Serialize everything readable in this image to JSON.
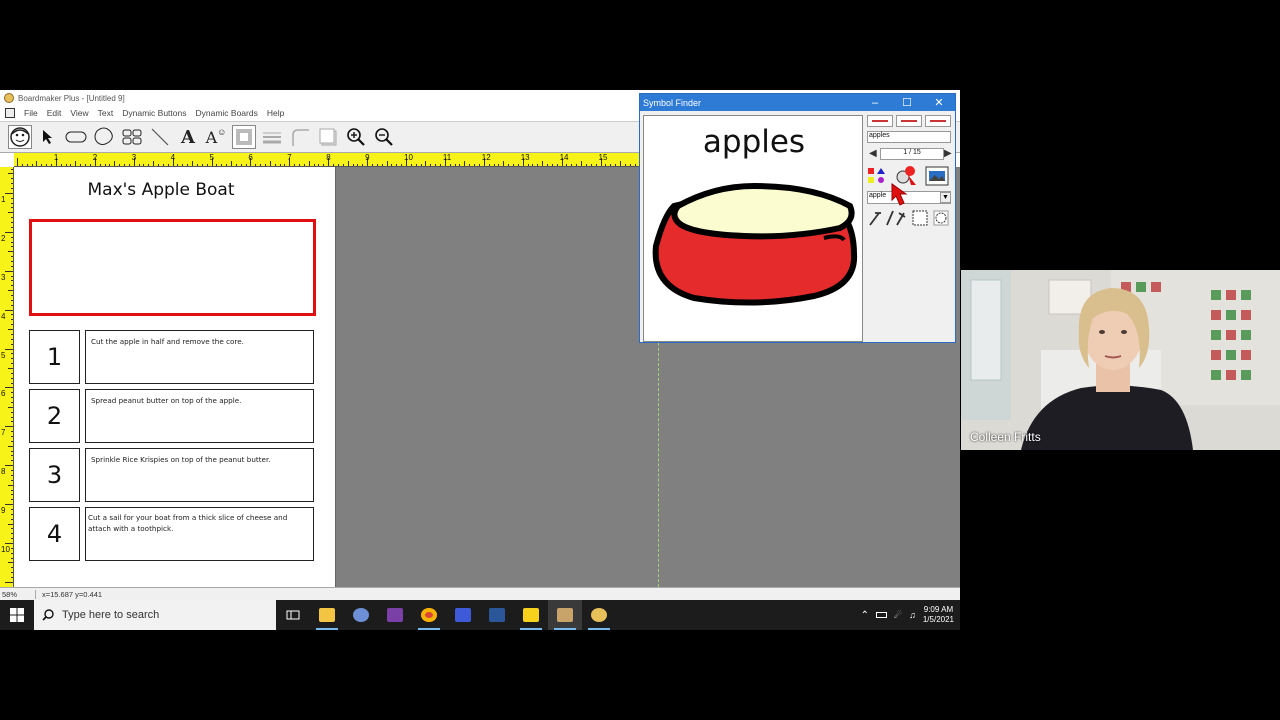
{
  "app": {
    "title": "Boardmaker Plus - [Untitled 9]",
    "menu": [
      "File",
      "Edit",
      "View",
      "Text",
      "Dynamic Buttons",
      "Dynamic Boards",
      "Help"
    ]
  },
  "toolbar": {
    "tools": [
      "symbol-finder-icon",
      "pointer-icon",
      "rounded-rect-icon",
      "freeform-icon",
      "button-grid-icon",
      "line-icon",
      "text-tool-icon",
      "spelling-icon",
      "fill-color-icon",
      "line-thickness-icon",
      "corner-icon",
      "shadow-icon",
      "zoom-in-icon",
      "zoom-out-icon"
    ]
  },
  "rulers": {
    "top_labels": [
      "1",
      "2",
      "3",
      "4",
      "5",
      "6",
      "7",
      "8",
      "9",
      "10",
      "11",
      "12",
      "13",
      "14",
      "15"
    ],
    "left_labels": [
      "1",
      "2",
      "3",
      "4",
      "5",
      "6",
      "7",
      "8",
      "9",
      "10"
    ]
  },
  "page": {
    "title": "Max's Apple Boat",
    "steps": [
      {
        "num": "1",
        "text": "Cut the apple in half and remove the core."
      },
      {
        "num": "2",
        "text": "Spread peanut butter on top of the apple."
      },
      {
        "num": "3",
        "text": "Sprinkle Rice Krispies on top of the peanut butter."
      },
      {
        "num": "4",
        "text": "Cut a sail for your boat from a thick slice of cheese and attach with a toothpick."
      }
    ]
  },
  "status": {
    "zoom": "58%",
    "coords": "x=15.687   y=0.441"
  },
  "symbol_finder": {
    "title": "Symbol Finder",
    "preview_word": "apples",
    "search_value": "apples",
    "page_indicator": "1 / 15",
    "category_value": "apple"
  },
  "taskbar": {
    "search_placeholder": "Type here to search",
    "time": "9:09 AM",
    "date": "1/5/2021"
  },
  "webcam": {
    "participant_name": "Colleen Fritts"
  },
  "colors": {
    "ruler": "#f7f318",
    "red_box": "#e01010",
    "title_bar": "#2e7bd6",
    "canvas": "#808080"
  }
}
